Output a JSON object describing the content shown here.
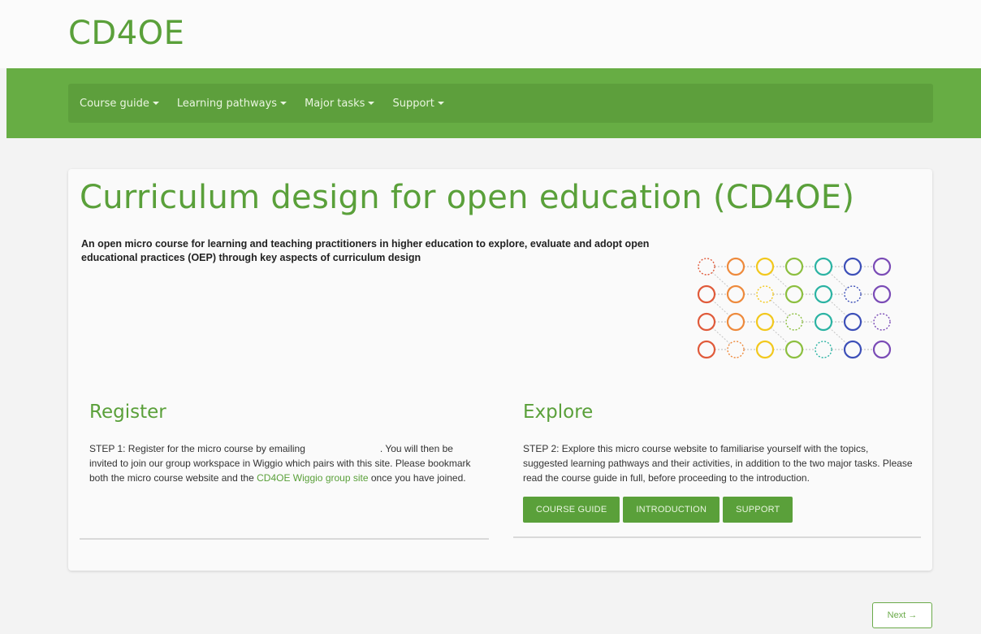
{
  "brand": "CD4OE",
  "nav": [
    {
      "label": "Course guide"
    },
    {
      "label": "Learning pathways"
    },
    {
      "label": "Major tasks"
    },
    {
      "label": "Support"
    }
  ],
  "main": {
    "title": "Curriculum design for open education (CD4OE)",
    "lead": "An open micro course for learning and teaching practitioners in higher education to explore, evaluate and adopt open educational practices (OEP) through key aspects of curriculum design",
    "register": {
      "heading": "Register",
      "text_1": "STEP 1: Register for the micro course by emailing",
      "text_2": ". You will then be invited to join our group workspace in Wiggio which pairs with this site. Please bookmark both the micro course website and the",
      "link": "CD4OE Wiggio group site",
      "text_3": "once you have joined."
    },
    "explore": {
      "heading": "Explore",
      "text": "STEP 2: Explore this micro course website to familiarise yourself with the topics, suggested learning pathways and their activities, in addition to the two major tasks. Please read the course guide in full, before proceeding to the introduction.",
      "buttons": [
        "COURSE GUIDE",
        "INTRODUCTION",
        "SUPPORT"
      ]
    }
  },
  "pager": {
    "next_label": "Next →"
  },
  "colors": {
    "accent": "#5aa03a",
    "nav_band": "#67ad44",
    "nav_inner": "#5d9f3c",
    "logo_palette": [
      "#e05a3a",
      "#ee8a3c",
      "#f2c81d",
      "#8cbf3f",
      "#2bb3a3",
      "#3c4fb8",
      "#7a4bb6"
    ]
  }
}
